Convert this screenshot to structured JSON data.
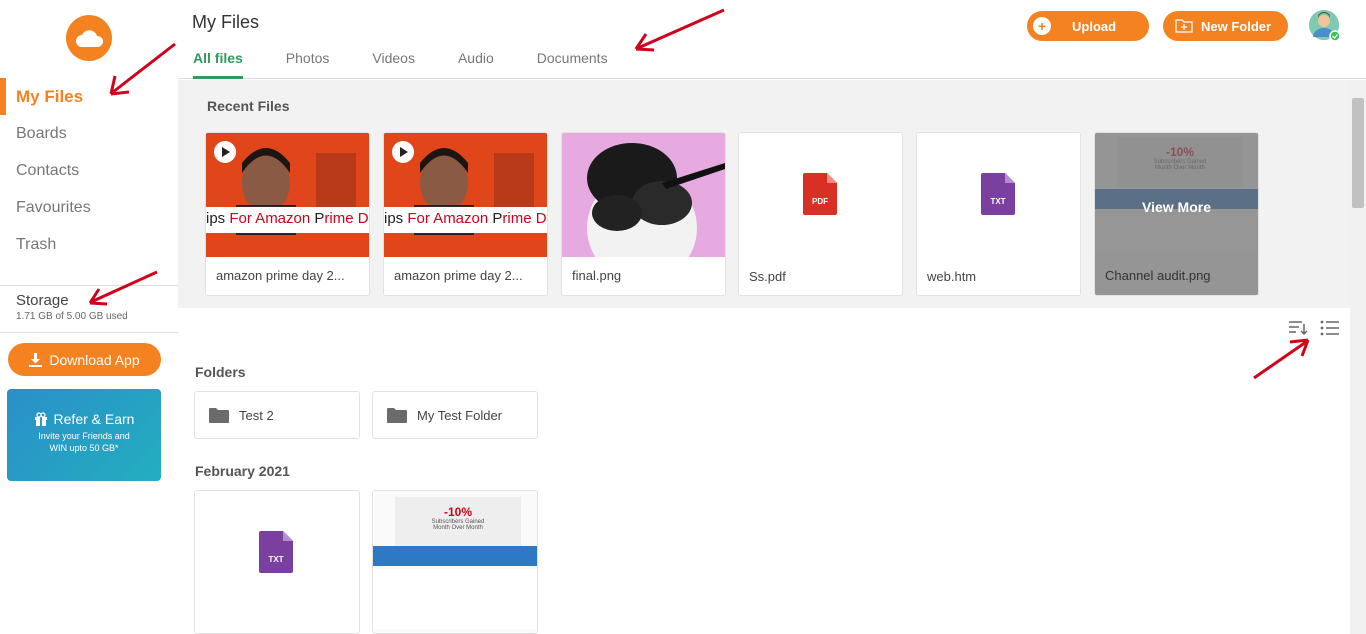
{
  "sidebar": {
    "nav": [
      {
        "label": "My Files",
        "active": true
      },
      {
        "label": "Boards"
      },
      {
        "label": "Contacts"
      },
      {
        "label": "Favourites"
      },
      {
        "label": "Trash"
      }
    ],
    "storage_title": "Storage",
    "storage_used": "1.71 GB of 5.00 GB used",
    "download_label": "Download App",
    "refer_title": "Refer & Earn",
    "refer_line1": "Invite your Friends and",
    "refer_line2": "WIN upto 50 GB*"
  },
  "header": {
    "title": "My Files",
    "tabs": [
      "All files",
      "Photos",
      "Videos",
      "Audio",
      "Documents"
    ],
    "upload_label": "Upload",
    "new_folder_label": "New Folder"
  },
  "recent": {
    "title": "Recent Files",
    "video_caption_a": "ips ",
    "video_caption_b": "For Amazon ",
    "video_caption_c": "P",
    "video_caption_d": "rime Day",
    "files": [
      {
        "name": "amazon prime day 2..."
      },
      {
        "name": "amazon prime day 2..."
      },
      {
        "name": "final.png"
      },
      {
        "name": "Ss.pdf",
        "badge": "PDF"
      },
      {
        "name": "web.htm",
        "badge": "TXT"
      },
      {
        "name": "Channel audit.png"
      }
    ],
    "view_more": "View More",
    "audit_pct": "-10%",
    "audit_sub": "Subscribers Gained",
    "audit_sub2": "Month Over Month"
  },
  "folders": {
    "title": "Folders",
    "items": [
      "Test 2",
      "My Test Folder"
    ]
  },
  "february": {
    "title": "February 2021",
    "txt_badge": "TXT"
  },
  "colors": {
    "accent": "#f58220",
    "tab_active": "#2e9c5a",
    "pdf": "#d93025",
    "txt": "#7b3fa0"
  }
}
